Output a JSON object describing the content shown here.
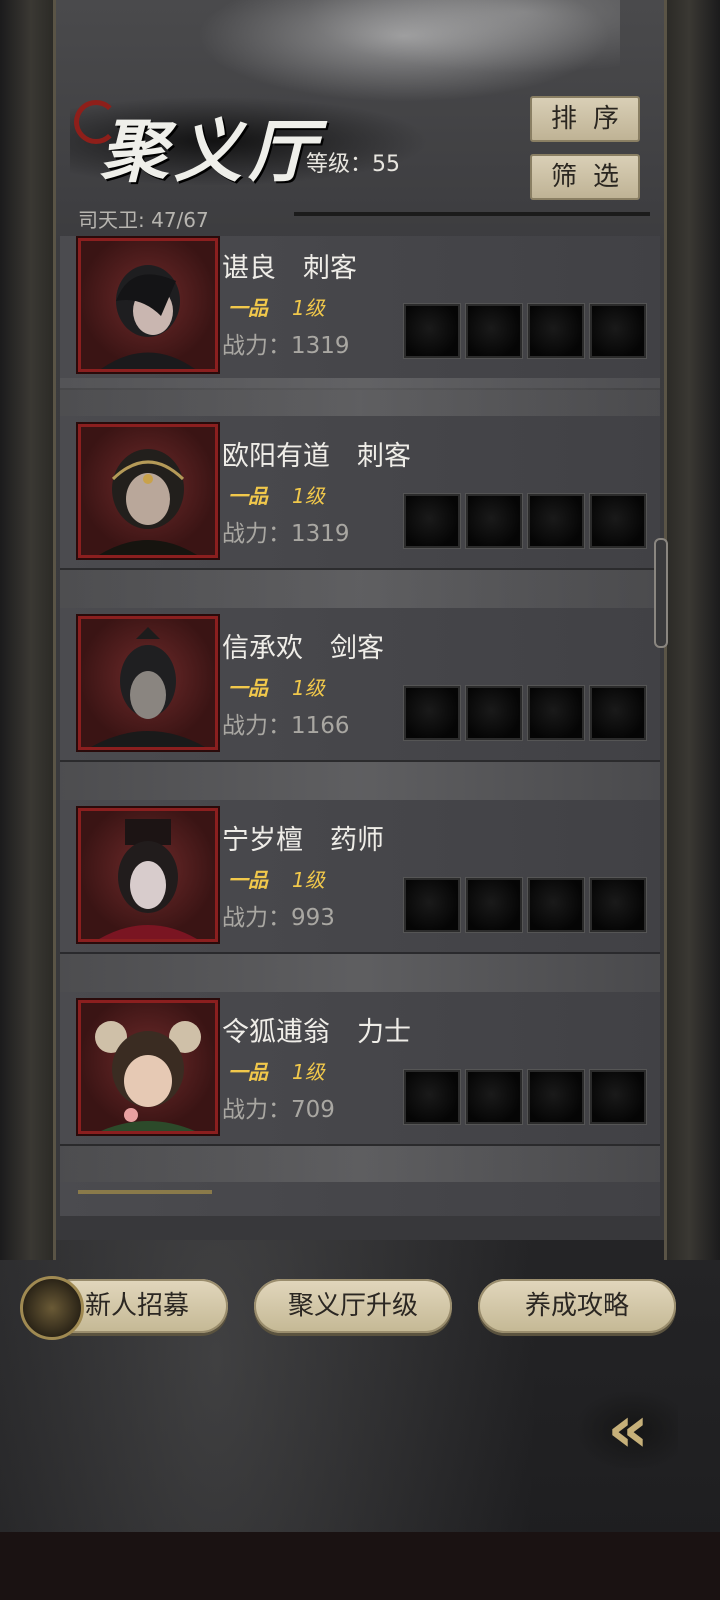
{
  "header": {
    "title": "聚义厅",
    "level_text": "等级：55",
    "sort_label": "排序",
    "filter_label": "筛选",
    "guards_text": "司天卫: 47/67"
  },
  "heroes": [
    {
      "name": "谌良　刺客",
      "rank": "一品",
      "level": "1级",
      "power": "战力：1319"
    },
    {
      "name": "欧阳有道　刺客",
      "rank": "一品",
      "level": "1级",
      "power": "战力：1319"
    },
    {
      "name": "信承欢　剑客",
      "rank": "一品",
      "level": "1级",
      "power": "战力：1166"
    },
    {
      "name": "宁岁檀　药师",
      "rank": "一品",
      "level": "1级",
      "power": "战力：993"
    },
    {
      "name": "令狐逋翁　力士",
      "rank": "一品",
      "level": "1级",
      "power": "战力：709"
    }
  ],
  "bottom_bar": {
    "recruit_label": "新人招募",
    "upgrade_label": "聚义厅升级",
    "guide_label": "养成攻略"
  },
  "icons": {
    "back": "double-chevron-left-icon",
    "recruit": "recruit-icon"
  },
  "colors": {
    "accent_gold": "#f1c84b",
    "portrait_border": "#8b1f1f",
    "button_cream": "#d9cfb6"
  }
}
